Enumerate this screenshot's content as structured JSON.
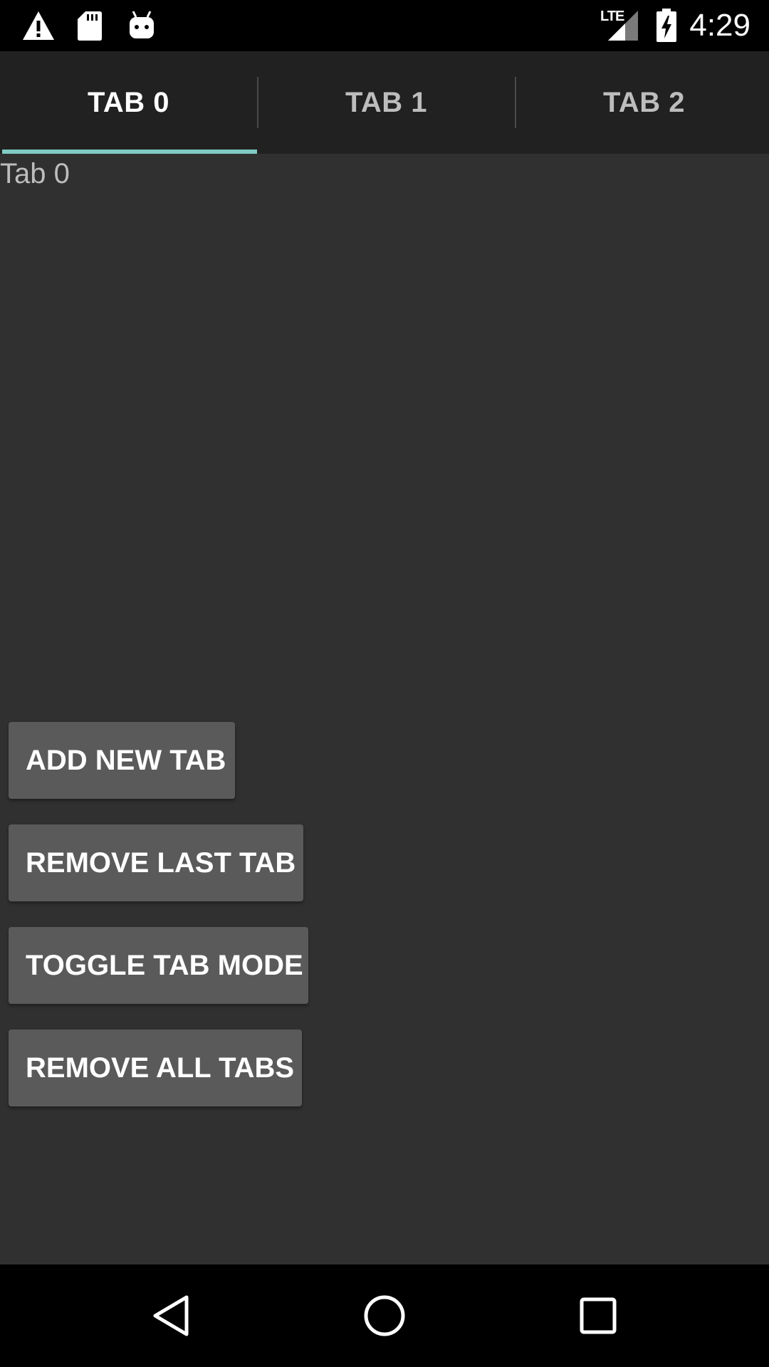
{
  "status_bar": {
    "time": "4:29",
    "network_label": "LTE",
    "icons": [
      "warning-icon",
      "sd-card-icon",
      "android-icon",
      "signal-icon",
      "battery-charging-icon"
    ]
  },
  "tabs": [
    {
      "label": "TAB 0",
      "selected": true
    },
    {
      "label": "TAB 1",
      "selected": false
    },
    {
      "label": "TAB 2",
      "selected": false
    }
  ],
  "content": {
    "label": "Tab 0"
  },
  "buttons": {
    "add": "ADD NEW TAB",
    "remove_last": "REMOVE LAST TAB",
    "toggle_mode": "TOGGLE TAB MODE",
    "remove_all": "REMOVE ALL TABS"
  },
  "navigation": {
    "icons": [
      "back-icon",
      "home-icon",
      "recents-icon"
    ]
  },
  "colors": {
    "background": "#303030",
    "tab_bar": "#212121",
    "indicator": "#80cbc4",
    "button": "#5a5a5b"
  }
}
